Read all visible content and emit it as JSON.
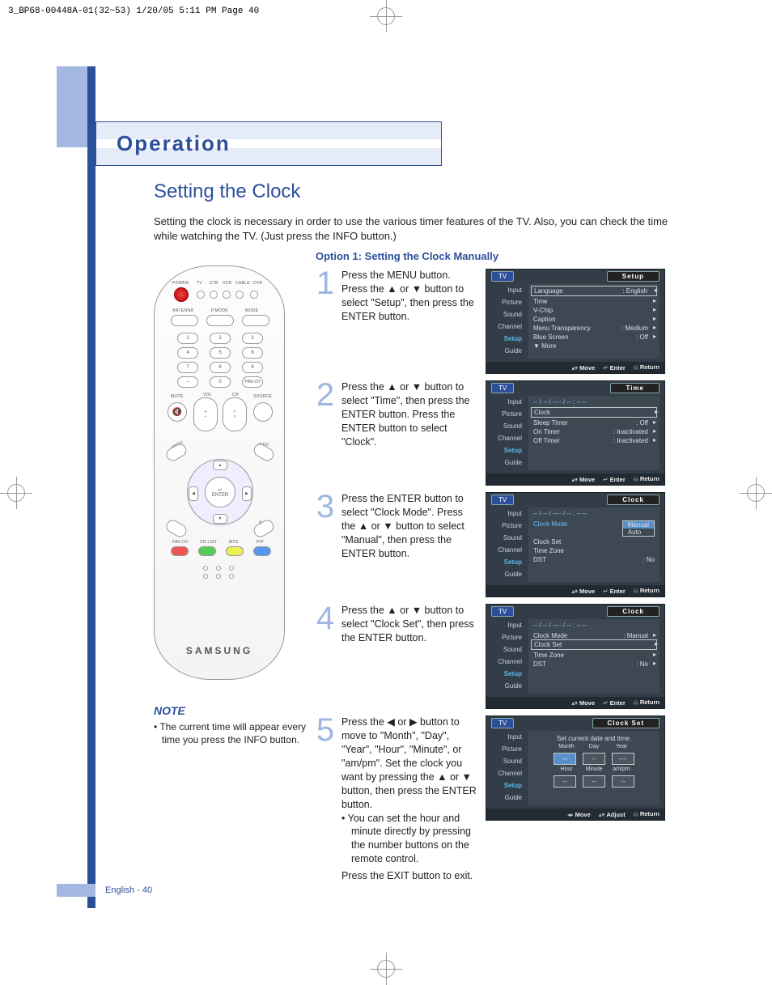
{
  "crop_header": "3_BP68-00448A-01(32~53)  1/20/05  5:11 PM  Page 40",
  "section": "Operation",
  "title": "Setting the Clock",
  "intro": "Setting the clock is necessary in order to use the various timer features of the TV. Also, you can check the time while watching the TV. (Just press the INFO button.)",
  "option_head": "Option 1: Setting the Clock Manually",
  "steps": [
    {
      "n": "1",
      "txt": "Press the MENU button. Press the ▲ or ▼ button to select \"Setup\", then press the ENTER button."
    },
    {
      "n": "2",
      "txt": "Press the ▲ or ▼ button to select \"Time\", then press the ENTER button. Press the ENTER button to select \"Clock\"."
    },
    {
      "n": "3",
      "txt": "Press the ENTER button to select \"Clock Mode\". Press the ▲ or ▼ button to select \"Manual\", then press the ENTER button."
    },
    {
      "n": "4",
      "txt": "Press the ▲ or ▼ button to select \"Clock Set\", then press the ENTER button."
    },
    {
      "n": "5",
      "txt": "Press the ◀ or ▶ button to move to \"Month\", \"Day\", \"Year\", \"Hour\", \"Minute\", or \"am/pm\". Set the clock you want by pressing the ▲ or ▼ button, then press the ENTER button.",
      "sub": "• You can set the hour and minute directly by pressing the number buttons on the remote control.",
      "exit": "Press the EXIT button to exit."
    }
  ],
  "osd": {
    "tabs": [
      "Input",
      "Picture",
      "Sound",
      "Channel",
      "Setup",
      "Guide"
    ],
    "foot_move": "Move",
    "foot_enter": "Enter",
    "foot_adjust": "Adjust",
    "foot_return": "Return",
    "screens": [
      {
        "tv": "TV",
        "title": "Setup",
        "hl": "Setup",
        "rows": [
          {
            "l": "Language",
            "r": ": English",
            "box": true,
            "ar": true
          },
          {
            "l": "Time",
            "r": "",
            "ar": true
          },
          {
            "l": "V-Chip",
            "r": "",
            "ar": true
          },
          {
            "l": "Caption",
            "r": "",
            "ar": true
          },
          {
            "l": "Menu Transparency",
            "r": ": Medium",
            "ar": true
          },
          {
            "l": "Blue Screen",
            "r": ": Off",
            "ar": true
          },
          {
            "l": "▼ More",
            "r": ""
          }
        ]
      },
      {
        "tv": "TV",
        "title": "Time",
        "hl": "Setup",
        "header": "-- / -- / ---- / -- : -- --",
        "rows": [
          {
            "l": "Clock",
            "r": "",
            "box": true,
            "ar": true
          },
          {
            "l": "Sleep Timer",
            "r": ": Off",
            "ar": true
          },
          {
            "l": "On Timer",
            "r": ": Inactivated",
            "ar": true
          },
          {
            "l": "Off Timer",
            "r": ": Inactivated",
            "ar": true
          }
        ]
      },
      {
        "tv": "TV",
        "title": "Clock",
        "hl": "Setup",
        "header": "-- / -- / ---- / -- : -- --",
        "rows": [
          {
            "l": "Clock Mode",
            "opts": [
              "Manual",
              "Auto"
            ],
            "on": 0
          },
          {
            "l": "Clock Set",
            "r": ""
          },
          {
            "l": "Time Zone",
            "r": ""
          },
          {
            "l": "DST",
            "r": ": No"
          }
        ]
      },
      {
        "tv": "TV",
        "title": "Clock",
        "hl": "Setup",
        "header": "-- / -- / ---- / -- : -- --",
        "rows": [
          {
            "l": "Clock Mode",
            "r": ": Manual",
            "ar": true
          },
          {
            "l": "Clock Set",
            "r": "",
            "box": true,
            "ar": true
          },
          {
            "l": "Time Zone",
            "r": "",
            "ar": true
          },
          {
            "l": "DST",
            "r": ": No",
            "ar": true
          }
        ]
      },
      {
        "tv": "TV",
        "title": "Clock Set",
        "hl": "Setup",
        "set_msg": "Set current date and time.",
        "set_labels1": [
          "Month",
          "Day",
          "Year"
        ],
        "set_vals1": [
          "--",
          "--",
          "----"
        ],
        "set_labels2": [
          "Hour",
          "Minute",
          "am/pm"
        ],
        "set_vals2": [
          "--",
          "--",
          "--"
        ],
        "foot_alt": true
      }
    ]
  },
  "remote": {
    "labels": {
      "power": "POWER",
      "tv": "TV",
      "stb": "STB",
      "vcr": "VCR",
      "cable": "CABLE",
      "dvd": "DVD",
      "antenna": "ANTENNA",
      "pmode": "P.MODE",
      "mode": "MODE",
      "mute": "MUTE",
      "vol": "VOL",
      "ch": "CH",
      "source": "SOURCE",
      "prech": "PRE-CH",
      "menu": "MENU",
      "info": "INFO",
      "exit": "EXIT",
      "enter": "ENTER",
      "favch": "FAV.CH",
      "chlist": "CH.LIST",
      "mts": "MTS",
      "pip": "PIP"
    },
    "brand": "SAMSUNG"
  },
  "note_head": "NOTE",
  "note_body": "• The current time will appear every time you press the INFO button.",
  "pagenum": "English - 40"
}
